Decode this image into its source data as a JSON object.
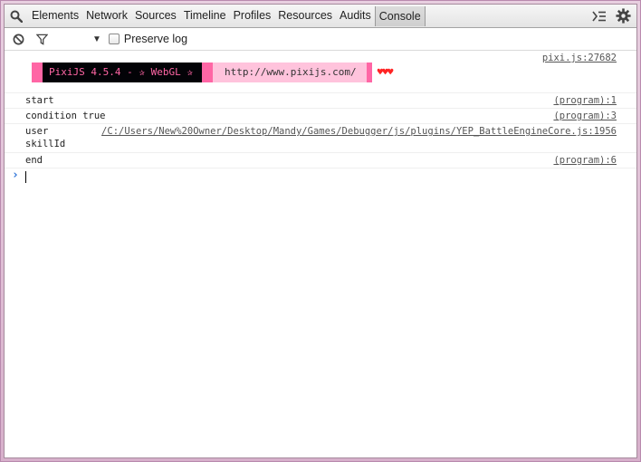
{
  "tabs": [
    "Elements",
    "Network",
    "Sources",
    "Timeline",
    "Profiles",
    "Resources",
    "Audits",
    "Console"
  ],
  "selected_tab": "Console",
  "toolbar": {
    "preserve_log_label": "Preserve log"
  },
  "pixi_banner": {
    "version_text": "PixiJS 4.5.4 - ✰ WebGL ✰",
    "url_text": "http://www.pixijs.com/",
    "hearts": "♥♥♥",
    "source": "pixi.js:27682"
  },
  "messages": [
    {
      "text": "start",
      "source": "(program):1"
    },
    {
      "text": "condition true",
      "source": "(program):3"
    },
    {
      "text_line1": "user",
      "text_line2": "skillId",
      "source": "/C:/Users/New%20Owner/Desktop/Mandy/Games/Debugger/js/plugins/YEP_BattleEngineCore.js:1956"
    },
    {
      "text": "end",
      "source": "(program):6"
    }
  ],
  "colors": {
    "accent_pink": "#ff66a5",
    "light_pink": "#ffc3dc",
    "prompt_blue": "#2d73d8",
    "heart_red": "#ff2424"
  }
}
